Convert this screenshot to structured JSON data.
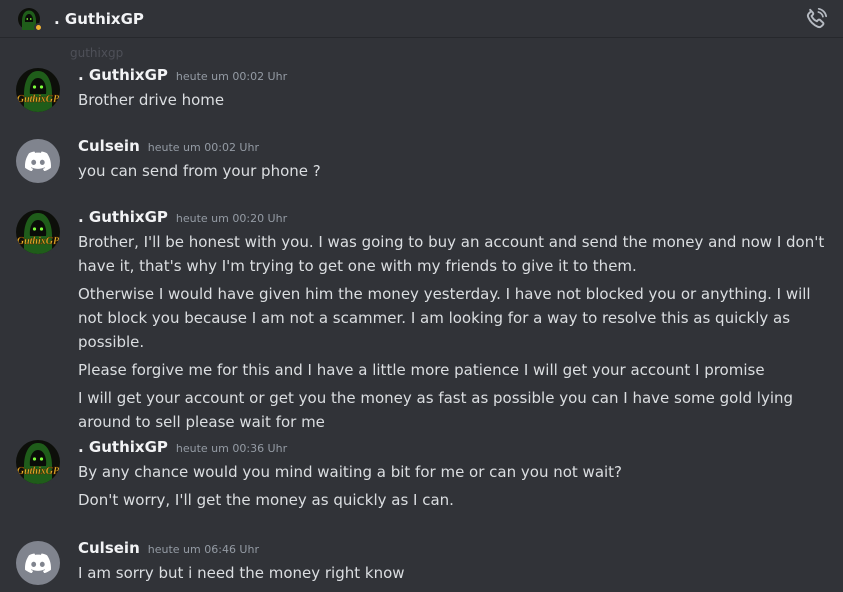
{
  "header": {
    "title": ". GuthixGP",
    "call_icon": "phone-call-icon"
  },
  "ghost_text": "guthixgp",
  "avatar_labels": {
    "guthix": "GuthixGP"
  },
  "messages": [
    {
      "author": ". GuthixGP",
      "avatar": "guthix",
      "time": "heute um 00:02 Uhr",
      "lines": [
        "Brother drive home"
      ]
    },
    {
      "author": "Culsein",
      "avatar": "discord",
      "time": "heute um 00:02 Uhr",
      "lines": [
        "you can send from your phone ?"
      ]
    },
    {
      "author": ". GuthixGP",
      "avatar": "guthix",
      "time": "heute um 00:20 Uhr",
      "lines": [
        "Brother, I'll be honest with you. I was going to buy an account and send the money and now I don't have it, that's why I'm trying to get one with my friends to give it to them.",
        "Otherwise I would have given him the money yesterday. I have not blocked you or anything. I will not block you because I am not a scammer. I am looking for a way to resolve this as quickly as possible.",
        "Please forgive me for this and I have a little more patience I will get your account I promise",
        "I will get your account or get you the money as fast as possible you can I have some gold lying around to sell please wait for me"
      ]
    },
    {
      "author": ". GuthixGP",
      "avatar": "guthix",
      "time": "heute um 00:36 Uhr",
      "lines": [
        "By any chance would you mind waiting a bit for me or can you not wait?",
        "Don't worry, I'll get the money as quickly as I can."
      ]
    },
    {
      "author": "Culsein",
      "avatar": "discord",
      "time": "heute um 06:46 Uhr",
      "lines": [
        "I am sorry but i need the money right know"
      ]
    }
  ],
  "colors": {
    "background": "#313338",
    "author": "#f2f3f5",
    "text": "#dbdee1",
    "timestamp": "#949ba4",
    "discord_avatar": "#80848e"
  }
}
